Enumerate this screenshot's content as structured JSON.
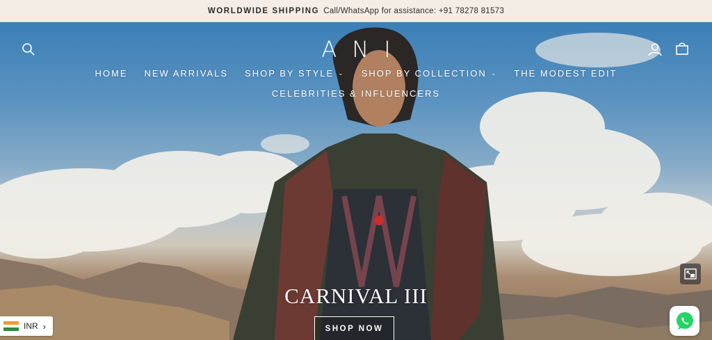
{
  "announcement": {
    "strong": "WORLDWIDE SHIPPING",
    "text": "Call/WhatsApp for assistance: +91 78278 81573"
  },
  "header": {
    "logo": "ANI",
    "icons": [
      "search-icon",
      "account-icon",
      "cart-icon"
    ]
  },
  "nav": {
    "items": [
      {
        "label": "HOME",
        "dropdown": false
      },
      {
        "label": "NEW ARRIVALS",
        "dropdown": false
      },
      {
        "label": "SHOP BY STYLE",
        "dropdown": true
      },
      {
        "label": "SHOP BY COLLECTION",
        "dropdown": true
      },
      {
        "label": "THE MODEST EDIT",
        "dropdown": false
      }
    ],
    "second_row": "CELEBRITIES & INFLUENCERS"
  },
  "hero": {
    "title": "CARNIVAL III",
    "cta": "SHOP NOW"
  },
  "currency": {
    "code": "INR",
    "flag_colors": [
      "#f29a2e",
      "#ffffff",
      "#2e8b3a"
    ]
  },
  "widgets": [
    "picture-in-picture-icon",
    "whatsapp-icon"
  ],
  "colors": {
    "announcement_bg": "#f3ede6",
    "whatsapp": "#25d366"
  }
}
